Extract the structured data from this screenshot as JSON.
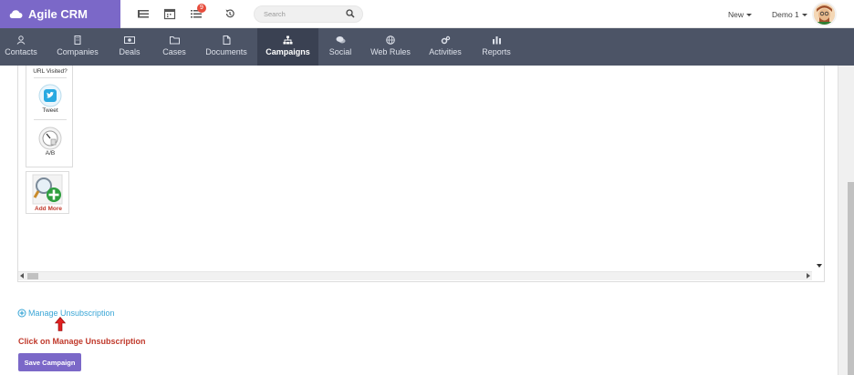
{
  "brand": {
    "name": "Agile CRM"
  },
  "topbar": {
    "notification_count": "9",
    "search_placeholder": "Search",
    "new_label": "New",
    "user_label": "Demo 1"
  },
  "nav": {
    "items": [
      {
        "label": "Contacts",
        "icon": "user-icon"
      },
      {
        "label": "Companies",
        "icon": "building-icon"
      },
      {
        "label": "Deals",
        "icon": "money-icon"
      },
      {
        "label": "Cases",
        "icon": "folder-icon"
      },
      {
        "label": "Documents",
        "icon": "file-icon"
      },
      {
        "label": "Campaigns",
        "icon": "sitemap-icon"
      },
      {
        "label": "Social",
        "icon": "comments-icon"
      },
      {
        "label": "Web Rules",
        "icon": "globe-icon"
      },
      {
        "label": "Activities",
        "icon": "gears-icon"
      },
      {
        "label": "Reports",
        "icon": "bar-chart-icon"
      }
    ],
    "active": "Campaigns"
  },
  "palette": {
    "items": [
      {
        "label": "URL Visited?",
        "icon": "url-icon"
      },
      {
        "label": "Tweet",
        "icon": "twitter-icon"
      },
      {
        "label": "A/B",
        "icon": "gauge-icon"
      }
    ],
    "add_more_label": "Add More"
  },
  "footer": {
    "manage_link": "Manage Unsubscription",
    "instruction": "Click on Manage Unsubscription",
    "save_button": "Save Campaign"
  },
  "colors": {
    "brand": "#7b68c8",
    "navbar": "#4c5466",
    "link": "#3aa6d6",
    "annotation": "#c0392b"
  }
}
